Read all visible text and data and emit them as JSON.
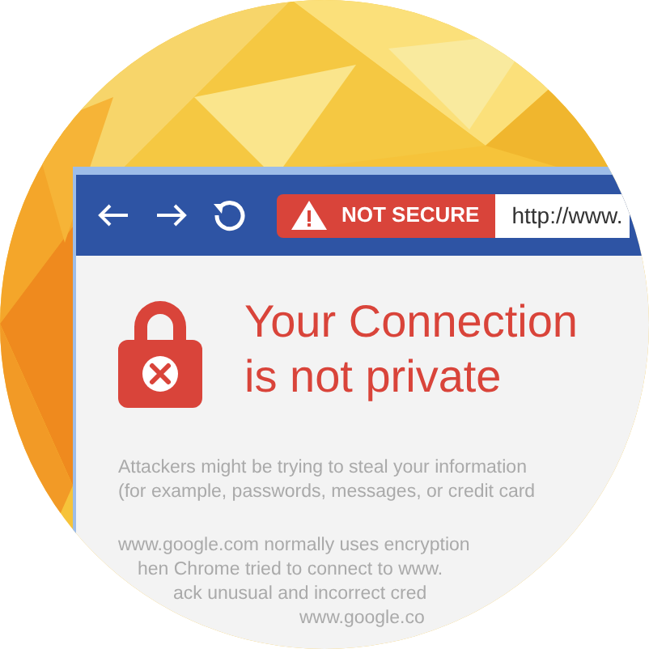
{
  "toolbar": {
    "buttons": [
      {
        "kind": "back"
      },
      {
        "kind": "forward"
      },
      {
        "kind": "reload"
      }
    ],
    "security_badge": "NOT SECURE",
    "url": "http://www."
  },
  "heading": [
    "Your Connection",
    "is not private"
  ],
  "paragraphs": [
    [
      "Attackers might be trying to steal your information",
      "(for example, passwords, messages, or credit card"
    ],
    [
      "www.google.com normally uses encryption",
      "hen Chrome tried to connect to www.",
      "ack unusual and incorrect cred",
      "www.google.co"
    ]
  ]
}
